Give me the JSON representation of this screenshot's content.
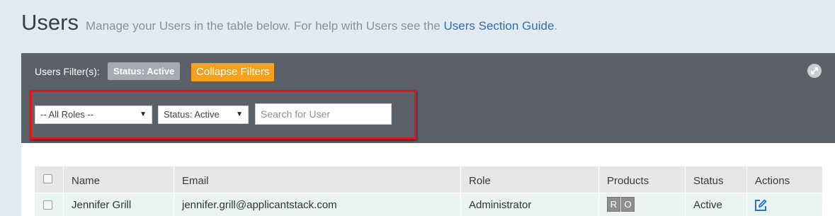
{
  "header": {
    "title": "Users",
    "subtitle": "Manage your Users in the table below. For help with Users see the",
    "guide_link": "Users Section Guide",
    "subtitle_end": "."
  },
  "filter_bar": {
    "label": "Users Filter(s):",
    "active_badge": "Status: Active",
    "collapse_label": "Collapse Filters",
    "role_select": {
      "value": "-- All Roles --"
    },
    "status_select": {
      "value": "Status: Active"
    },
    "search": {
      "placeholder": "Search for User",
      "value": ""
    }
  },
  "table": {
    "headers": [
      "Name",
      "Email",
      "Role",
      "Products",
      "Status",
      "Actions"
    ],
    "rows": [
      {
        "name": "Jennifer Grill",
        "email": "jennifer.grill@applicantstack.com",
        "role": "Administrator",
        "products": [
          "R",
          "O"
        ],
        "status": "Active"
      }
    ]
  },
  "colors": {
    "filter_bar": "#5c6169",
    "collapse_button": "#f4a020",
    "link": "#2c6fb3",
    "highlight": "#e0141b",
    "row_bg": "#e9f4f3"
  },
  "icons": {
    "expand": "expand-icon",
    "edit": "edit-icon",
    "dropdown": "triangle-down-icon"
  }
}
